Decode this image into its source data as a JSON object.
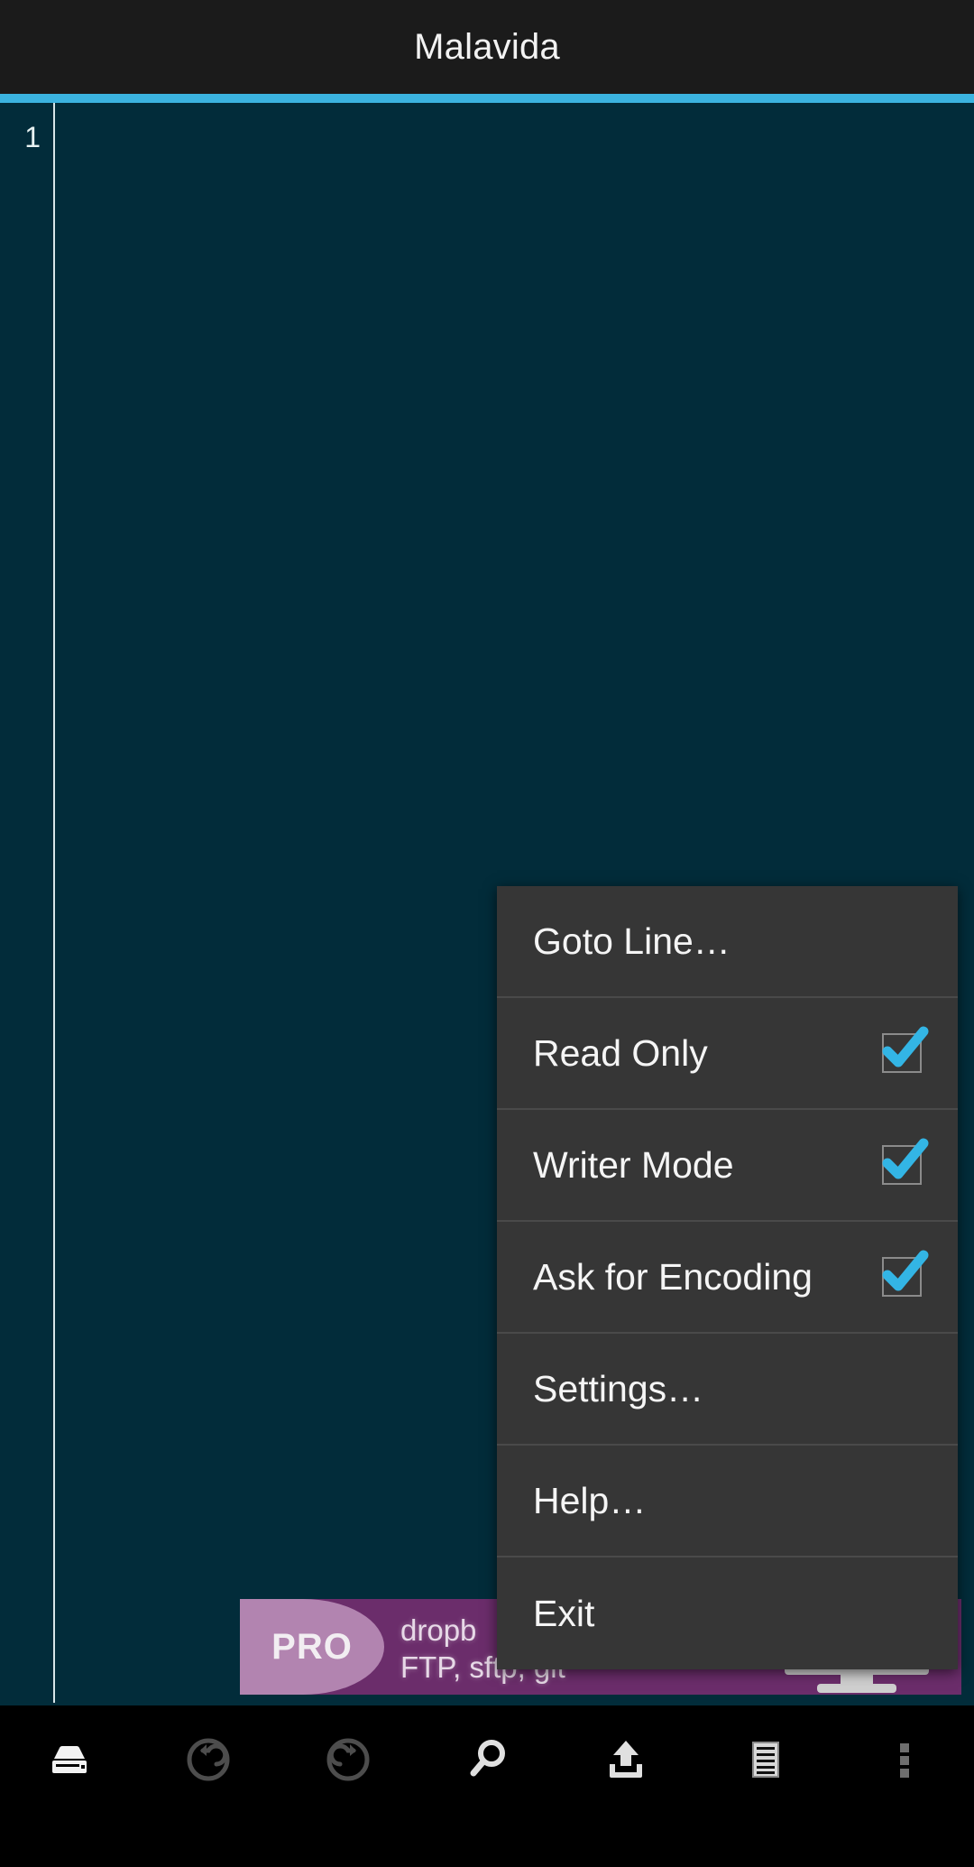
{
  "app": {
    "title": "Malavida",
    "accent_color": "#3bb3e0",
    "titlebar_bg": "#1b1b1b",
    "editor_bg": "#022c3a"
  },
  "editor": {
    "line_numbers": [
      "1"
    ],
    "content": ""
  },
  "menu": {
    "items": [
      {
        "label": "Goto Line…",
        "icon": "",
        "checkbox": false,
        "checked": false
      },
      {
        "label": "Read Only",
        "icon": "check-icon",
        "checkbox": true,
        "checked": true
      },
      {
        "label": "Writer Mode",
        "icon": "check-icon",
        "checkbox": true,
        "checked": true
      },
      {
        "label": "Ask for Encoding",
        "icon": "check-icon",
        "checkbox": true,
        "checked": true
      },
      {
        "label": "Settings…",
        "icon": "",
        "checkbox": false,
        "checked": false
      },
      {
        "label": "Help…",
        "icon": "",
        "checkbox": false,
        "checked": false
      },
      {
        "label": "Exit",
        "icon": "",
        "checkbox": false,
        "checked": false
      }
    ],
    "checkbox_color": "#33b5e5",
    "bg_color": "#363636"
  },
  "ad": {
    "badge": "PRO",
    "line1": "dropb",
    "line2": "FTP, sftp, git",
    "badge_bg": "#b284b0",
    "banner_bg": "#6b2d6b",
    "icon": "monitor-icon"
  },
  "toolbar": {
    "buttons": [
      {
        "name": "save-icon",
        "label": "Save",
        "enabled": true
      },
      {
        "name": "undo-icon",
        "label": "Undo",
        "enabled": false
      },
      {
        "name": "redo-icon",
        "label": "Redo",
        "enabled": false
      },
      {
        "name": "search-icon",
        "label": "Search",
        "enabled": true
      },
      {
        "name": "upload-icon",
        "label": "Upload",
        "enabled": true
      },
      {
        "name": "document-icon",
        "label": "Document",
        "enabled": true
      },
      {
        "name": "overflow-menu-icon",
        "label": "More",
        "enabled": false
      }
    ],
    "enabled_color": "#e0e0e0",
    "disabled_color": "#555555"
  }
}
